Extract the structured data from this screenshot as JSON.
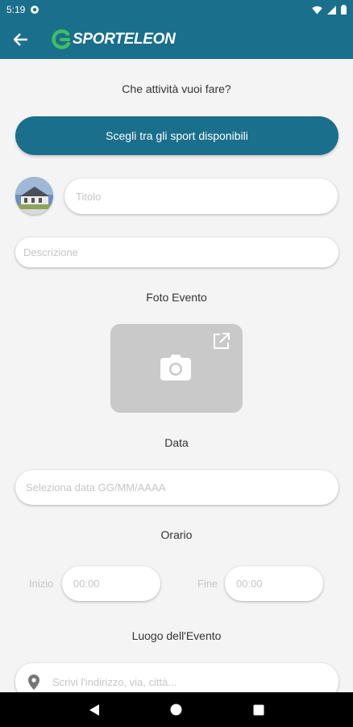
{
  "status_bar": {
    "time": "5:19"
  },
  "app_bar": {
    "logo_text": "SPORTELEON"
  },
  "form": {
    "activity_prompt": "Che attività vuoi fare?",
    "choose_sport_label": "Scegli tra gli sport disponibili",
    "title_placeholder": "Titolo",
    "description_placeholder": "Descrizione",
    "photo_label": "Foto Evento",
    "date_label": "Data",
    "date_placeholder": "Seleziona data GG/MM/AAAA",
    "time_label": "Orario",
    "start_label": "Inizio",
    "start_value": "00:00",
    "end_label": "Fine",
    "end_value": "00:00",
    "location_label": "Luogo dell'Evento",
    "address_placeholder": "Scrivi l'indirizzo, via, città..."
  },
  "colors": {
    "primary": "#1a6f8c",
    "logo_green": "#3fbf5f"
  }
}
